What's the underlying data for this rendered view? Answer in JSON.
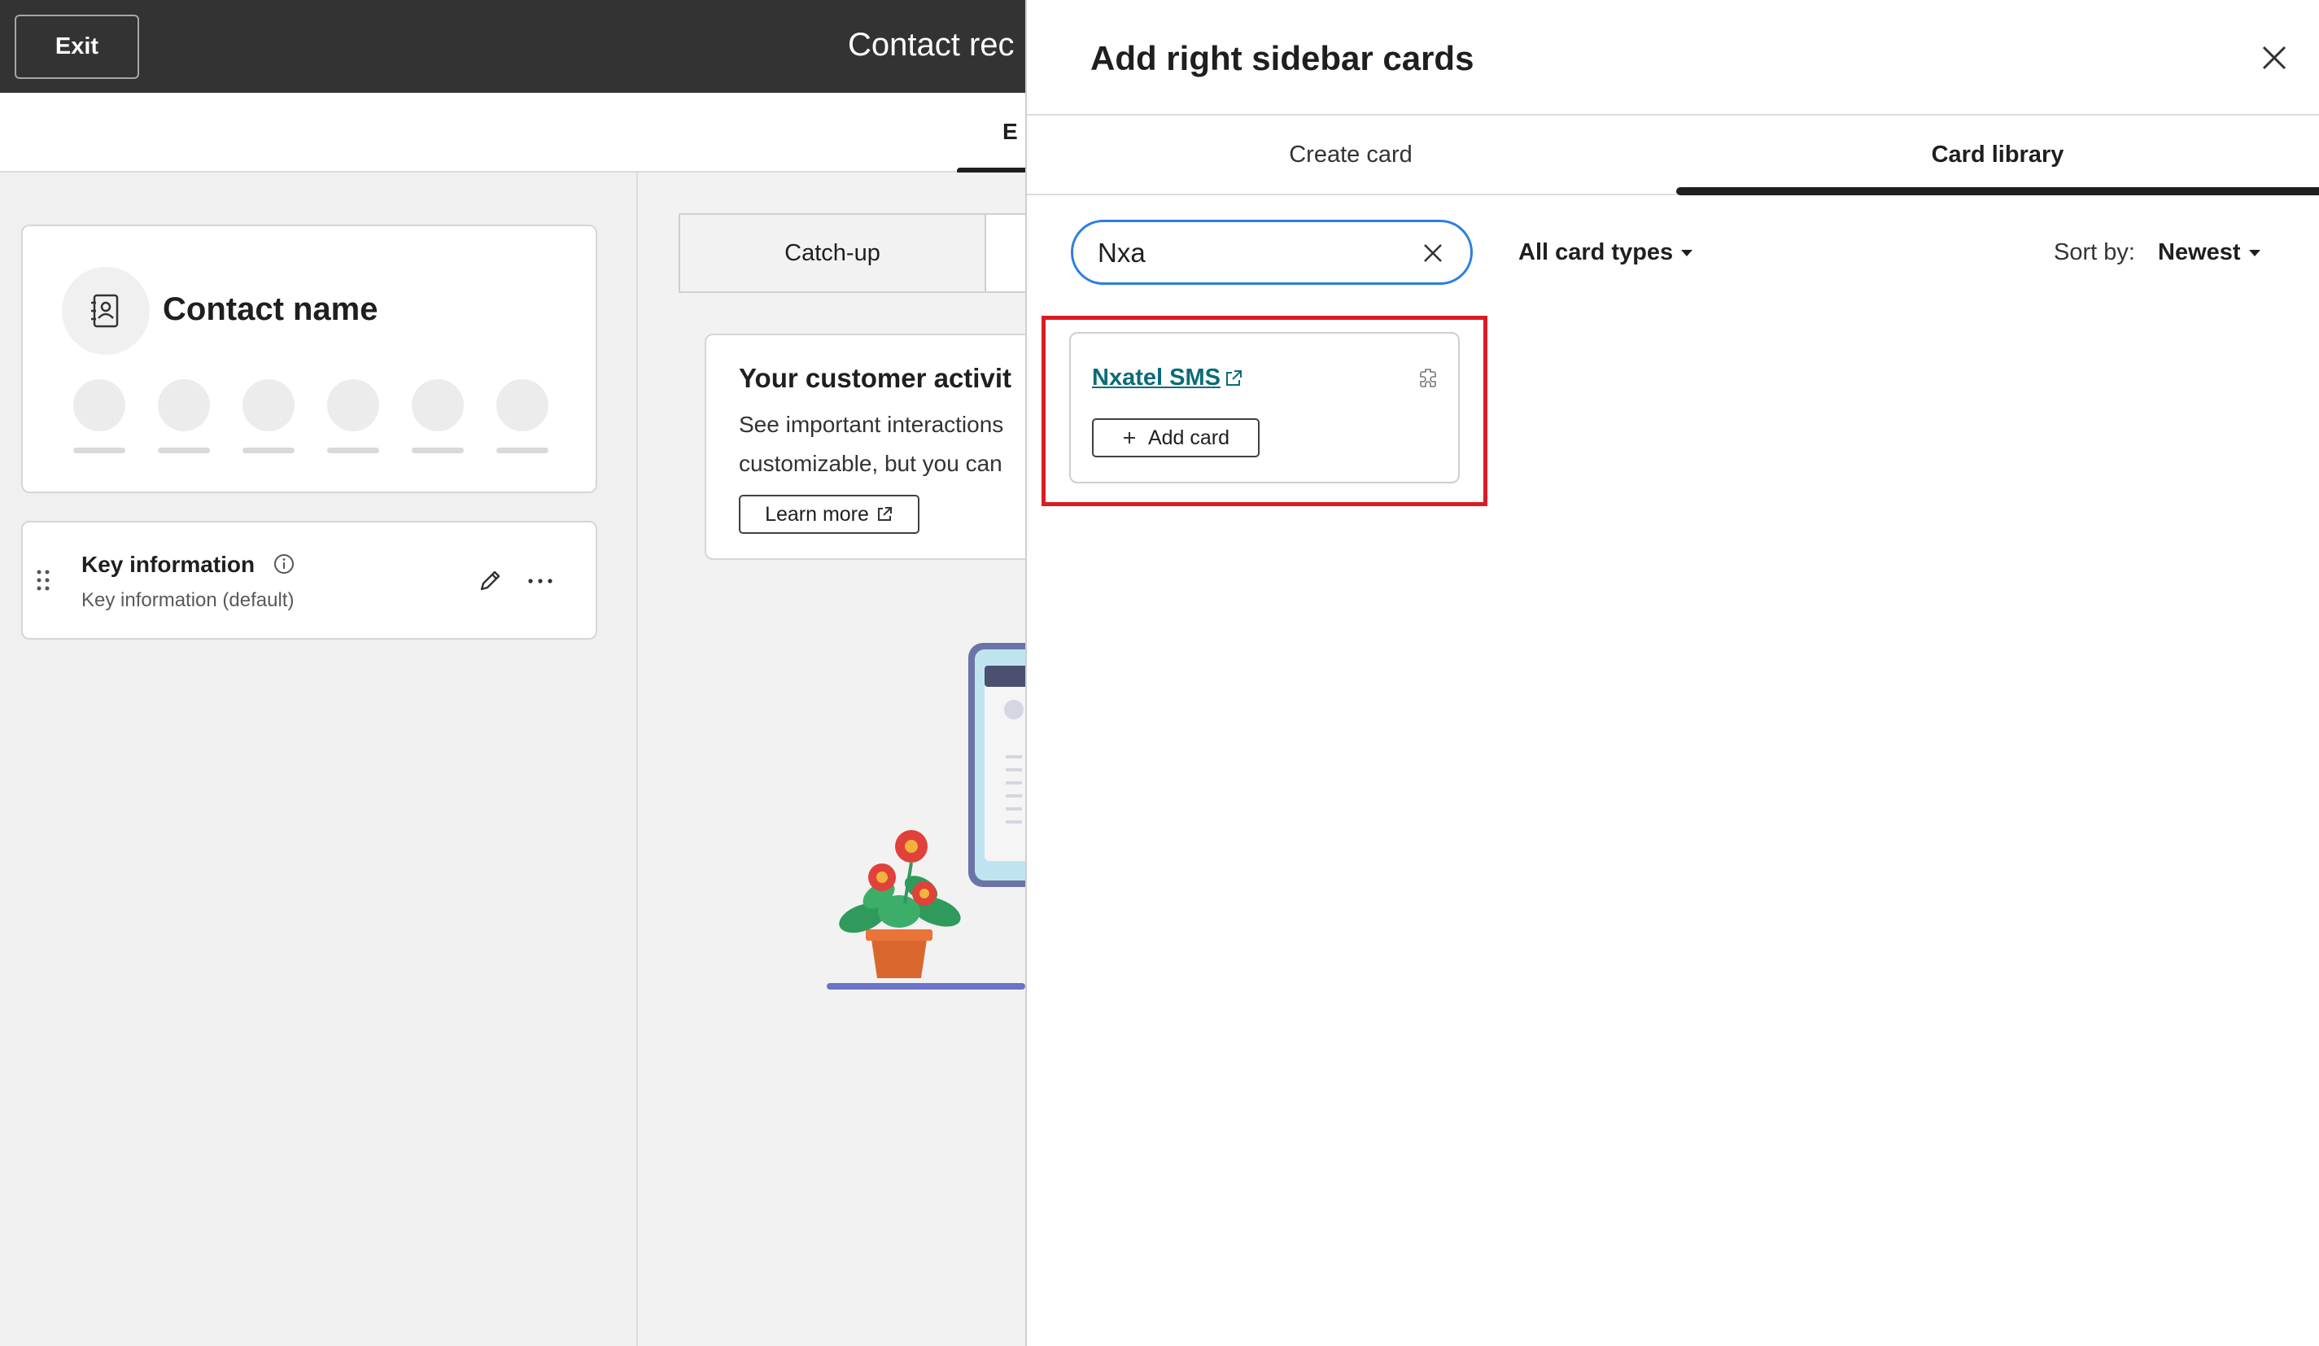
{
  "topbar": {
    "exit_label": "Exit",
    "title": "Contact rec"
  },
  "subbar": {
    "tab_label": "E"
  },
  "left": {
    "contact_name": "Contact name",
    "key_card": {
      "title": "Key information",
      "subtitle": "Key information (default)"
    }
  },
  "middle": {
    "tab_label": "Catch-up",
    "activity": {
      "title": "Your customer activit",
      "line1": "See important interactions",
      "line2": "customizable, but you can",
      "learn_more": "Learn more"
    }
  },
  "panel": {
    "title": "Add right sidebar cards",
    "tabs": [
      {
        "label": "Create card",
        "active": false
      },
      {
        "label": "Card library",
        "active": true
      }
    ],
    "search": {
      "value": "Nxa",
      "placeholder": ""
    },
    "filter_label": "All card types",
    "sort_label": "Sort by:",
    "sort_value": "Newest",
    "results": [
      {
        "name": "Nxatel SMS",
        "button": "Add card"
      }
    ]
  },
  "colors": {
    "topbar": "#333333",
    "link": "#0b6b78",
    "focus": "#2b7fe0",
    "highlight": "#d91c24"
  }
}
